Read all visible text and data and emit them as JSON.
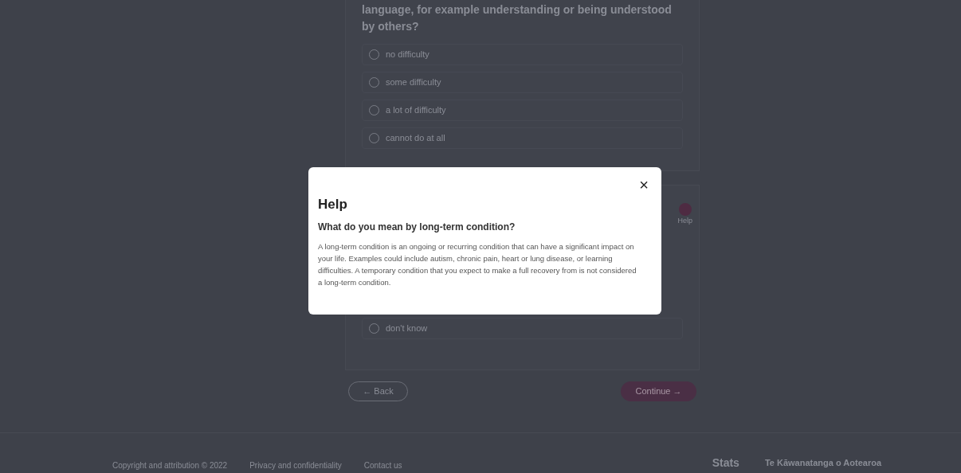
{
  "question_card": {
    "question_text": "language, for example understanding or being understood by others?",
    "options": [
      {
        "label": "no difficulty",
        "selected": false
      },
      {
        "label": "some difficulty",
        "selected": false
      },
      {
        "label": "a lot of difficulty",
        "selected": false
      },
      {
        "label": "cannot do at all",
        "selected": false
      }
    ]
  },
  "second_card": {
    "help_label": "Help",
    "options": [
      {
        "label": "don't know",
        "selected": false
      }
    ]
  },
  "navigation": {
    "back": "← Back",
    "continue": "Continue →"
  },
  "footer": {
    "links": [
      "Copyright and attribution © 2022",
      "Privacy and confidentiality",
      "Contact us"
    ],
    "stats_logo": "Stats",
    "government_text": "Te Kāwanatanga o Aotearoa"
  },
  "modal": {
    "title": "Help",
    "heading": "What do you mean by long-term condition?",
    "body": "A long-term condition is an ongoing or recurring condition that can have a significant impact on your life. Examples could include autism, chronic pain, heart or lung disease, or learning difficulties. A temporary condition that you expect to make a full recovery from is not considered a long-term condition.",
    "close": "×"
  }
}
